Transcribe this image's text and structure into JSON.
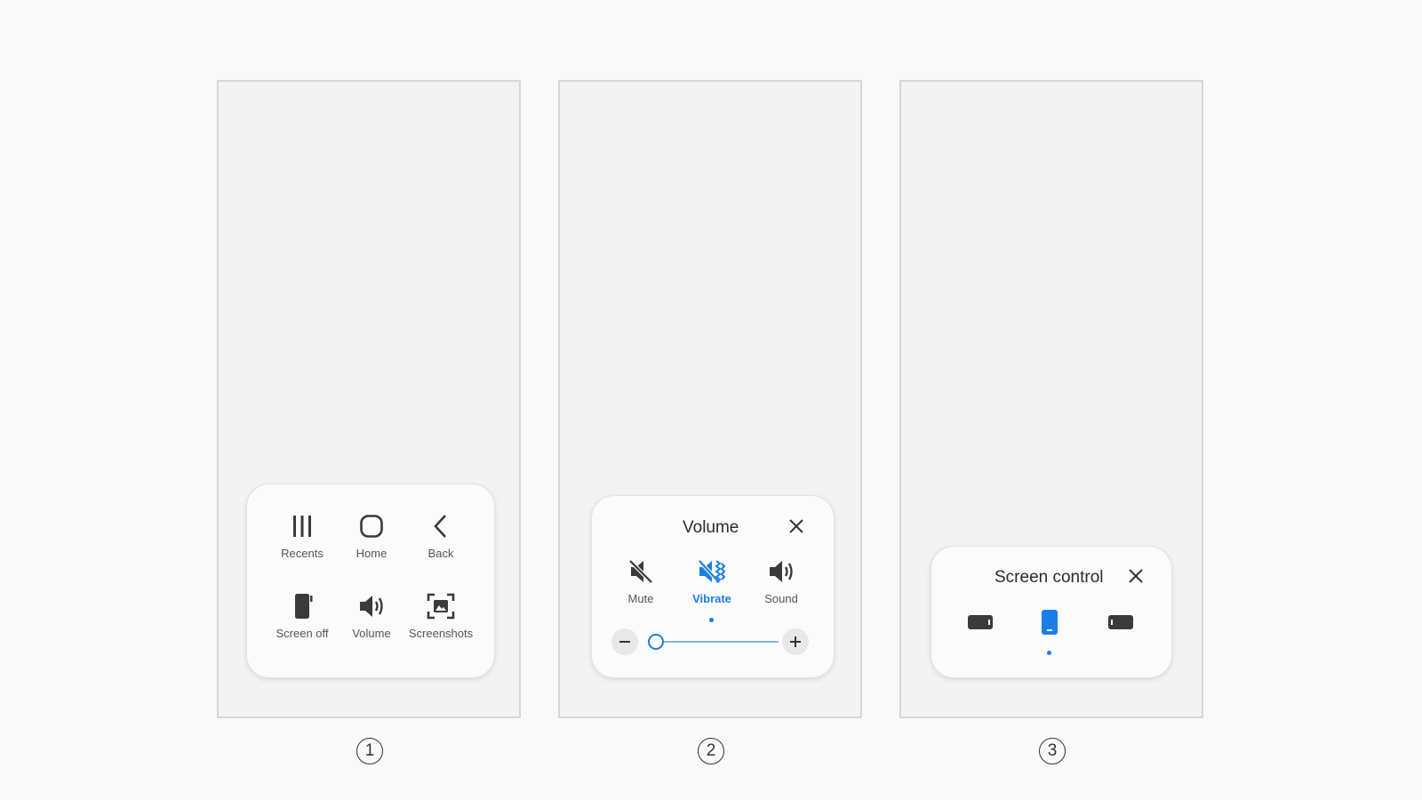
{
  "screens": [
    {
      "number": "1",
      "menu": [
        {
          "label": "Recents",
          "icon": "recents-icon"
        },
        {
          "label": "Home",
          "icon": "home-icon"
        },
        {
          "label": "Back",
          "icon": "back-icon"
        },
        {
          "label": "Screen off",
          "icon": "screen-off-icon"
        },
        {
          "label": "Volume",
          "icon": "volume-icon"
        },
        {
          "label": "Screenshots",
          "icon": "screenshot-icon"
        }
      ]
    },
    {
      "number": "2",
      "title": "Volume",
      "modes": [
        {
          "label": "Mute",
          "icon": "mute-icon",
          "active": false
        },
        {
          "label": "Vibrate",
          "icon": "vibrate-icon",
          "active": true
        },
        {
          "label": "Sound",
          "icon": "sound-icon",
          "active": false
        }
      ],
      "volume_level": 0
    },
    {
      "number": "3",
      "title": "Screen control",
      "orientations": [
        {
          "icon": "landscape-left-icon",
          "active": false
        },
        {
          "icon": "portrait-icon",
          "active": true
        },
        {
          "icon": "landscape-right-icon",
          "active": false
        }
      ]
    }
  ],
  "colors": {
    "accent": "#1a7ee8",
    "icon": "#3a3a3a",
    "panel": "#fbfbfb",
    "screen": "#f3f3f3"
  }
}
